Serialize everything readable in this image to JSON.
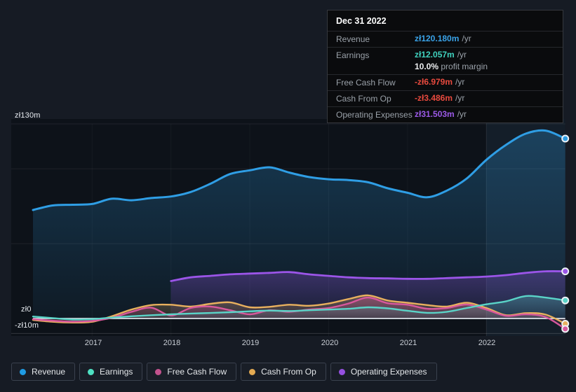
{
  "tooltip": {
    "date": "Dec 31 2022",
    "rows": [
      {
        "label": "Revenue",
        "value": "zł120.180m",
        "suffix": "/yr",
        "color": "#3aa3e8"
      },
      {
        "label": "Earnings",
        "value": "zł12.057m",
        "suffix": "/yr",
        "color": "#40d2bf",
        "sub_bold": "10.0%",
        "sub_text": " profit margin"
      },
      {
        "label": "Free Cash Flow",
        "value": "-zł6.979m",
        "suffix": "/yr",
        "color": "#e84a3e"
      },
      {
        "label": "Cash From Op",
        "value": "-zł3.486m",
        "suffix": "/yr",
        "color": "#e84a3e"
      },
      {
        "label": "Operating Expenses",
        "value": "zł31.503m",
        "suffix": "/yr",
        "color": "#9c5ae8"
      }
    ]
  },
  "axis": {
    "y_labels": [
      {
        "text": "zł130m",
        "value": 130
      },
      {
        "text": "zł0",
        "value": 0
      },
      {
        "text": "-zł10m",
        "value": -10
      }
    ],
    "x_ticks": [
      "2017",
      "2018",
      "2019",
      "2020",
      "2021",
      "2022"
    ]
  },
  "legend": {
    "items": [
      {
        "label": "Revenue",
        "color": "#1f9ce4"
      },
      {
        "label": "Earnings",
        "color": "#4ee0c2"
      },
      {
        "label": "Free Cash Flow",
        "color": "#c2528d"
      },
      {
        "label": "Cash From Op",
        "color": "#e3aa52"
      },
      {
        "label": "Operating Expenses",
        "color": "#9550e0"
      }
    ]
  },
  "chart_data": {
    "type": "area",
    "unit": "zł millions per year",
    "x": [
      2016.25,
      2016.5,
      2016.75,
      2017,
      2017.25,
      2017.5,
      2017.75,
      2018,
      2018.25,
      2018.5,
      2018.75,
      2019,
      2019.25,
      2019.5,
      2019.75,
      2020,
      2020.25,
      2020.5,
      2020.75,
      2021,
      2021.25,
      2021.5,
      2021.75,
      2022,
      2022.25,
      2022.5,
      2022.75,
      2023
    ],
    "series": [
      {
        "name": "Revenue",
        "color": "#2f9ee5",
        "line_width": 3,
        "values": [
          72.5,
          75.5,
          76,
          76.5,
          80,
          79,
          80.5,
          81.5,
          84.5,
          90,
          96.5,
          99,
          101,
          97.5,
          94.5,
          93,
          92.5,
          91,
          87,
          84,
          81,
          85.5,
          93.5,
          106,
          116,
          123.5,
          125.5,
          120.18
        ]
      },
      {
        "name": "Operating Expenses",
        "color": "#9b55e8",
        "line_width": 2.8,
        "values": [
          null,
          null,
          null,
          null,
          null,
          null,
          null,
          25,
          27.5,
          28.5,
          29.5,
          30,
          30.5,
          31,
          29.5,
          28.5,
          27.5,
          27,
          26.8,
          26.5,
          26.5,
          27,
          27.5,
          28,
          29,
          30.5,
          31.5,
          31.503
        ]
      },
      {
        "name": "Cash From Op",
        "color": "#e8b05e",
        "line_width": 2.4,
        "values": [
          -1,
          -2.2,
          -2.7,
          -2.2,
          1.5,
          6,
          9,
          9.2,
          8,
          9.8,
          10.8,
          7.5,
          7.8,
          9.2,
          8.5,
          10,
          13,
          15.5,
          12,
          10.5,
          9,
          8,
          10.5,
          7,
          2.2,
          3.6,
          2.6,
          -3.486
        ]
      },
      {
        "name": "Free Cash Flow",
        "color": "#d8589d",
        "line_width": 2.4,
        "values": [
          -0.5,
          -1.5,
          -2.1,
          -1.6,
          0.5,
          4.5,
          7.2,
          2,
          7,
          8,
          5.5,
          2.8,
          5.5,
          4.5,
          6,
          7,
          10,
          14,
          10.2,
          9.2,
          6.5,
          7,
          9.3,
          6,
          1.8,
          2.8,
          1,
          -6.979
        ]
      },
      {
        "name": "Earnings",
        "color": "#5ad4c8",
        "line_width": 2.4,
        "values": [
          1.3,
          0.3,
          -0.7,
          -0.4,
          0.6,
          1.5,
          2.2,
          2.8,
          3.3,
          3.7,
          4.2,
          4.8,
          5.3,
          5,
          5.5,
          6,
          6.5,
          7.5,
          6.8,
          5.2,
          3.8,
          4.5,
          7,
          9.5,
          11.5,
          15,
          14,
          12.057
        ]
      }
    ],
    "xlim": [
      2016.25,
      2023.0
    ],
    "ylim": [
      -10,
      130
    ],
    "x_tick_years": [
      2017,
      2018,
      2019,
      2020,
      2021,
      2022
    ],
    "gridline_values": [
      130,
      100,
      50,
      0,
      -10
    ],
    "highlight_from_year": 2022.0,
    "end_point_markers": true,
    "legend_position": "bottom"
  }
}
